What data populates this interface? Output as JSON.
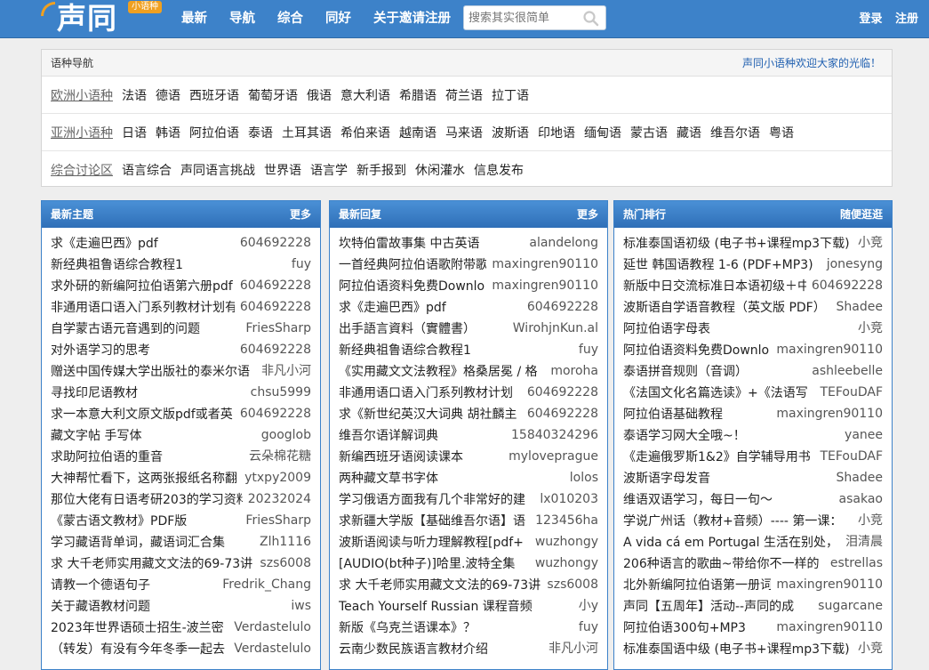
{
  "header": {
    "logo_text": "声同",
    "logo_badge": "小语种",
    "nav": [
      "最新",
      "导航",
      "综合",
      "同好",
      "关于邀请注册"
    ],
    "search_placeholder": "搜索其实很简单",
    "login": "登录",
    "register": "注册"
  },
  "langnav": {
    "title": "语种导航",
    "welcome": "声同小语种欢迎大家的光临！",
    "rows": [
      {
        "cat": "欧洲小语种",
        "items": [
          "法语",
          "德语",
          "西班牙语",
          "葡萄牙语",
          "俄语",
          "意大利语",
          "希腊语",
          "荷兰语",
          "拉丁语"
        ]
      },
      {
        "cat": "亚洲小语种",
        "items": [
          "日语",
          "韩语",
          "阿拉伯语",
          "泰语",
          "土耳其语",
          "希伯来语",
          "越南语",
          "马来语",
          "波斯语",
          "印地语",
          "缅甸语",
          "蒙古语",
          "藏语",
          "维吾尔语",
          "粤语"
        ]
      },
      {
        "cat": "综合讨论区",
        "items": [
          "语言综合",
          "声同语言挑战",
          "世界语",
          "语言学",
          "新手报到",
          "休闲灌水",
          "信息发布"
        ]
      }
    ]
  },
  "columns": [
    {
      "title": "最新主题",
      "more": "更多",
      "rows": [
        {
          "subject": "求《走遍巴西》pdf",
          "author": "604692228"
        },
        {
          "subject": "新经典祖鲁语综合教程1",
          "author": "fuy"
        },
        {
          "subject": "求外研的新编阿拉伯语第六册pdf",
          "author": "604692228"
        },
        {
          "subject": "非通用语口语入门系列教材计划有",
          "author": "604692228"
        },
        {
          "subject": "自学蒙古语元音遇到的问题",
          "author": "FriesSharp"
        },
        {
          "subject": "对外语学习的思考",
          "author": "604692228"
        },
        {
          "subject": "赠送中国传媒大学出版社的泰米尔语",
          "author": "非凡小河"
        },
        {
          "subject": "寻找印尼语教材",
          "author": "chsu5999"
        },
        {
          "subject": "求一本意大利文原文版pdf或者英",
          "author": "604692228"
        },
        {
          "subject": "藏文字帖 手写体",
          "author": "googlob"
        },
        {
          "subject": "求助阿拉伯语的重音",
          "author": "云朵棉花糖"
        },
        {
          "subject": "大神帮忙看下，这两张报纸名称翻",
          "author": "ytxpy2009"
        },
        {
          "subject": "那位大佬有日语考研203的学习资料",
          "author": "20232024"
        },
        {
          "subject": "《蒙古语文教材》PDF版",
          "author": "FriesSharp"
        },
        {
          "subject": "学习藏语背单词，藏语词汇合集",
          "author": "Zlh1116"
        },
        {
          "subject": "求 大千老师实用藏文文法的69-73讲",
          "author": "szs6008"
        },
        {
          "subject": "请教一个德语句子",
          "author": "Fredrik_Chang"
        },
        {
          "subject": "关于藏语教材问题",
          "author": "iws"
        },
        {
          "subject": "2023年世界语硕士招生-波兰密",
          "author": "Verdastelulo"
        },
        {
          "subject": "（转发）有没有今年冬季一起去",
          "author": "Verdastelulo"
        }
      ]
    },
    {
      "title": "最新回复",
      "more": "更多",
      "rows": [
        {
          "subject": "坎特伯雷故事集 中古英语",
          "author": "alandelong"
        },
        {
          "subject": "一首经典阿拉伯语歌附带歌",
          "author": "maxingren90110"
        },
        {
          "subject": "阿拉伯语资料免费Downlo",
          "author": "maxingren90110"
        },
        {
          "subject": "求《走遍巴西》pdf",
          "author": "604692228"
        },
        {
          "subject": "出手語言資料（實體書）",
          "author": "WirohjnKun.al"
        },
        {
          "subject": "新经典祖鲁语综合教程1",
          "author": "fuy"
        },
        {
          "subject": "《实用藏文文法教程》格桑居冕 / 格",
          "author": "moroha"
        },
        {
          "subject": "非通用语口语入门系列教材计划",
          "author": "604692228"
        },
        {
          "subject": "求《新世纪英汉大词典 胡社麟主",
          "author": "604692228"
        },
        {
          "subject": "维吾尔语详解词典",
          "author": "15840324296"
        },
        {
          "subject": "新编西班牙语阅读课本",
          "author": "myloveprague"
        },
        {
          "subject": "两种藏文草书字体",
          "author": "lolos"
        },
        {
          "subject": "学习俄语方面我有几个非常好的建",
          "author": "lx010203"
        },
        {
          "subject": "求新疆大学版【基础维吾尔语】语",
          "author": "123456ha"
        },
        {
          "subject": "波斯语阅读与听力理解教程[pdf+",
          "author": "wuzhongy"
        },
        {
          "subject": "[AUDIO(bt种子)]哈里.波特全集",
          "author": "wuzhongy"
        },
        {
          "subject": "求 大千老师实用藏文文法的69-73讲",
          "author": "szs6008"
        },
        {
          "subject": "Teach Yourself Russian 课程音频",
          "author": "小y"
        },
        {
          "subject": "新版《乌克兰语课本》？",
          "author": "fuy"
        },
        {
          "subject": "云南少数民族语言教材介绍",
          "author": "非凡小河"
        }
      ]
    },
    {
      "title": "热门排行",
      "more": "随便逛逛",
      "rows": [
        {
          "subject": "标准泰国语初级 (电子书+课程mp3下载)",
          "author": "小竞"
        },
        {
          "subject": "延世 韩国语教程 1-6 (PDF+MP3)",
          "author": "jonesyng"
        },
        {
          "subject": "新版中日交流标准日本语初级＋中",
          "author": "604692228"
        },
        {
          "subject": "波斯语自学语音教程（英文版 PDF）",
          "author": "Shadee"
        },
        {
          "subject": "阿拉伯语字母表",
          "author": "小竞"
        },
        {
          "subject": "阿拉伯语资料免费Downlo",
          "author": "maxingren90110"
        },
        {
          "subject": "泰语拼音规则（音调）",
          "author": "ashleebelle"
        },
        {
          "subject": "《法国文化名篇选读》+《法语写",
          "author": "TEFouDAF"
        },
        {
          "subject": "阿拉伯语基础教程",
          "author": "maxingren90110"
        },
        {
          "subject": "泰语学习网大全哦~！",
          "author": "yanee"
        },
        {
          "subject": "《走遍俄罗斯1&2》自学辅导用书",
          "author": "TEFouDAF"
        },
        {
          "subject": "波斯语字母发音",
          "author": "Shadee"
        },
        {
          "subject": "维语双语学习，每日一句～",
          "author": "asakao"
        },
        {
          "subject": "学说广州话（教材+音频）---- 第一课：",
          "author": "小竞"
        },
        {
          "subject": "A vida cá em Portugal 生活在别处，",
          "author": "泪清晨"
        },
        {
          "subject": "206种语言的歌曲~带给你不一样的",
          "author": "estrellas"
        },
        {
          "subject": "北外新编阿拉伯语第一册词",
          "author": "maxingren90110"
        },
        {
          "subject": "声同【五周年】活动--声同的成",
          "author": "sugarcane"
        },
        {
          "subject": "阿拉伯语300句+MP3",
          "author": "maxingren90110"
        },
        {
          "subject": "标准泰国语中级 (电子书+课程mp3下载)",
          "author": "小竞"
        }
      ]
    }
  ]
}
